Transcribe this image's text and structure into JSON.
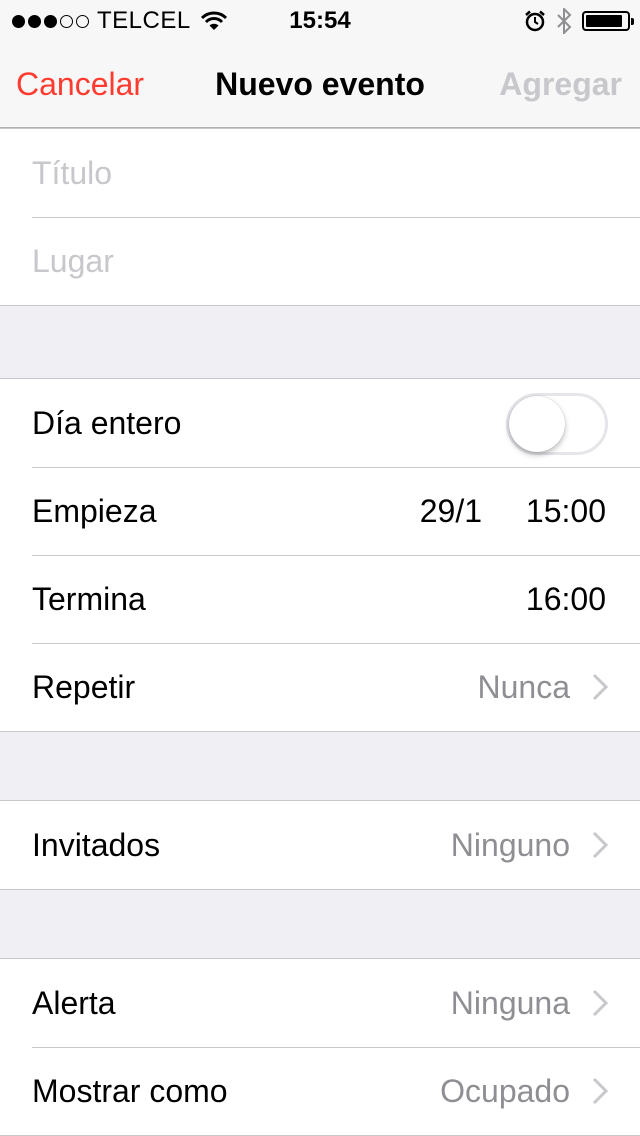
{
  "status_bar": {
    "signal_bars_filled": 3,
    "signal_bars_total": 5,
    "carrier": "TELCEL",
    "time": "15:54",
    "icons": [
      "wifi-icon",
      "alarm-icon",
      "bluetooth-icon",
      "battery-icon"
    ],
    "battery_level": 0.9
  },
  "nav": {
    "cancel": "Cancelar",
    "title": "Nuevo evento",
    "add": "Agregar"
  },
  "title_section": {
    "title_placeholder": "Título",
    "title_value": "",
    "location_placeholder": "Lugar",
    "location_value": ""
  },
  "time_section": {
    "all_day_label": "Día entero",
    "all_day_on": false,
    "starts_label": "Empieza",
    "starts_date": "29/1",
    "starts_time": "15:00",
    "ends_label": "Termina",
    "ends_time": "16:00",
    "repeat_label": "Repetir",
    "repeat_value": "Nunca"
  },
  "invitees_section": {
    "label": "Invitados",
    "value": "Ninguno"
  },
  "alert_section": {
    "alert_label": "Alerta",
    "alert_value": "Ninguna",
    "show_as_label": "Mostrar como",
    "show_as_value": "Ocupado"
  },
  "colors": {
    "accent_red": "#ff3b30",
    "disabled_gray": "#c7c7cc",
    "value_gray": "#8e8e93",
    "background": "#efeff4"
  }
}
